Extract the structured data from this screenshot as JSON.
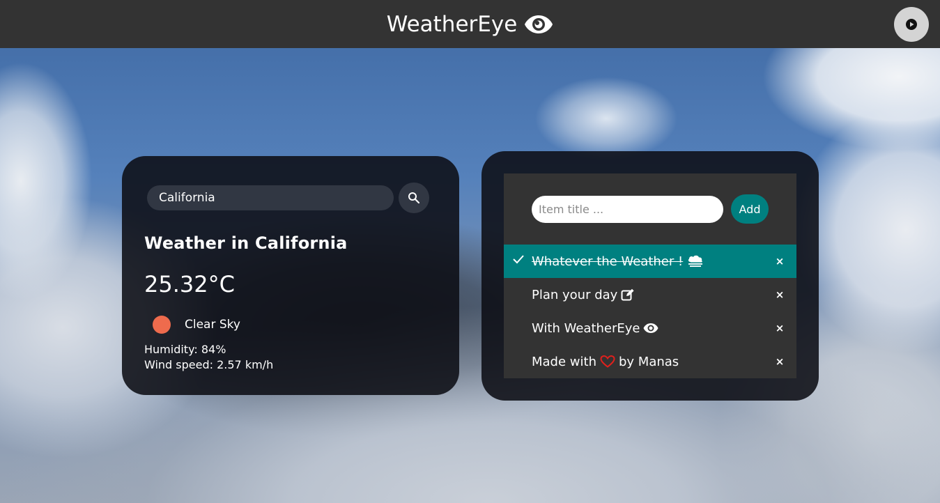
{
  "app": {
    "title": "WeatherEye"
  },
  "colors": {
    "topbar": "#333333",
    "accent": "#008080",
    "sun": "#ee6b4d",
    "heart": "#e0201c"
  },
  "weather": {
    "search_value": "California",
    "heading": "Weather in California",
    "temperature": "25.32°C",
    "description": "Clear Sky",
    "humidity": "Humidity: 84%",
    "wind": "Wind speed: 2.57 km/h"
  },
  "todo": {
    "placeholder": "Item title ...",
    "add_label": "Add",
    "items": [
      {
        "text": "Whatever the Weather !",
        "icon": "cloud-icon",
        "checked": true
      },
      {
        "text": "Plan your day",
        "icon": "edit-icon",
        "checked": false
      },
      {
        "text": "With WeatherEye",
        "icon": "eye-icon",
        "checked": false
      },
      {
        "text_before": "Made with",
        "icon": "heart-icon",
        "text_after": "by Manas",
        "checked": false
      }
    ],
    "close_glyph": "×"
  }
}
